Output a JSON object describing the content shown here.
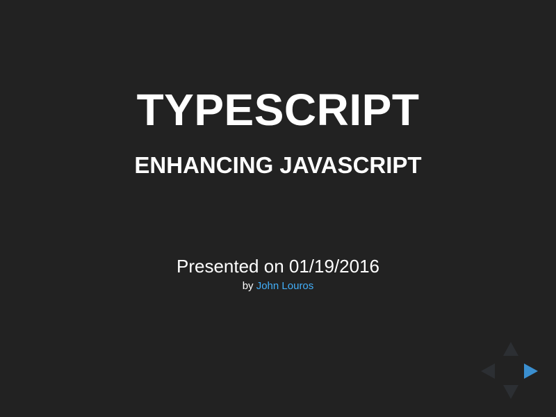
{
  "slide": {
    "title": "TYPESCRIPT",
    "subtitle": "ENHANCING JAVASCRIPT",
    "presented": "Presented on 01/19/2016",
    "by_prefix": "by",
    "author": "John Louros"
  },
  "controls": {
    "up": {
      "icon": "arrow-up-icon",
      "enabled": false
    },
    "down": {
      "icon": "arrow-down-icon",
      "enabled": false
    },
    "left": {
      "icon": "arrow-left-icon",
      "enabled": false
    },
    "right": {
      "icon": "arrow-right-icon",
      "enabled": true
    }
  },
  "colors": {
    "background": "#222222",
    "text": "#ffffff",
    "link": "#42affa",
    "control_active": "#3a8fd0",
    "control_inactive": "#2c2f33"
  }
}
